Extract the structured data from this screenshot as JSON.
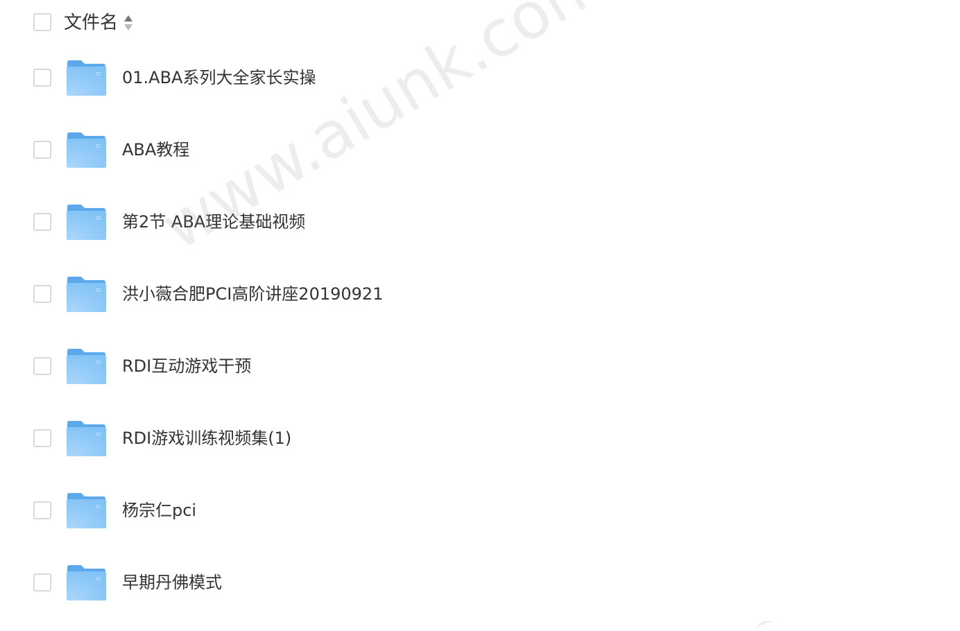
{
  "header": {
    "column_label": "文件名",
    "sort_icon": "sort-icon"
  },
  "files": [
    {
      "name": "01.ABA系列大全家长实操",
      "icon": "folder-icon"
    },
    {
      "name": "ABA教程",
      "icon": "folder-icon"
    },
    {
      "name": "第2节 ABA理论基础视频",
      "icon": "folder-icon"
    },
    {
      "name": "洪小薇合肥PCI高阶讲座20190921",
      "icon": "folder-icon"
    },
    {
      "name": "RDI互动游戏干预",
      "icon": "folder-icon"
    },
    {
      "name": "RDI游戏训练视频集(1)",
      "icon": "folder-icon"
    },
    {
      "name": "杨宗仁pci",
      "icon": "folder-icon"
    },
    {
      "name": "早期丹佛模式",
      "icon": "folder-icon"
    }
  ],
  "watermark": {
    "text": "www.aiunk.com"
  },
  "colors": {
    "folder_back": "#5ba8ec",
    "folder_front": "#8cc8f7",
    "checkbox_border": "#d9d9d9",
    "text": "#333333"
  }
}
